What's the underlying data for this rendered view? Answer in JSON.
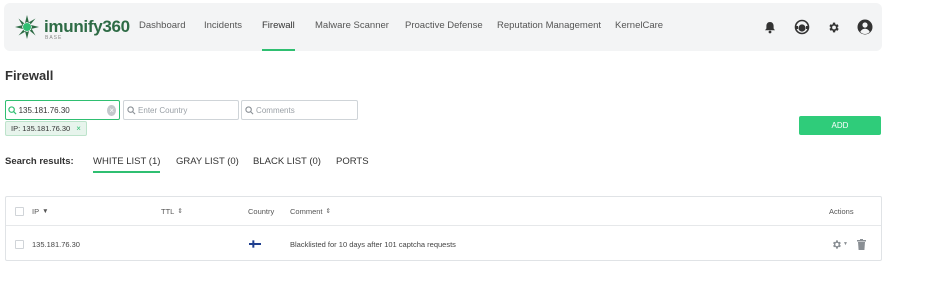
{
  "brand": {
    "name": "imunify360",
    "sub": "BASE",
    "color": "#2d6b45"
  },
  "nav": [
    {
      "label": "Dashboard"
    },
    {
      "label": "Incidents"
    },
    {
      "label": "Firewall",
      "active": true
    },
    {
      "label": "Malware Scanner"
    },
    {
      "label": "Proactive Defense"
    },
    {
      "label": "Reputation Management"
    },
    {
      "label": "KernelCare"
    }
  ],
  "top_icons": [
    "bell-icon",
    "support-icon",
    "gear-icon",
    "user-avatar-icon"
  ],
  "page": {
    "title": "Firewall"
  },
  "filters": {
    "ip_value": "135.181.76.30",
    "country_placeholder": "Enter Country",
    "comments_placeholder": "Comments",
    "chip": "IP: 135.181.76.30",
    "chip_close": "×"
  },
  "add_label": "ADD",
  "results": {
    "label": "Search results:",
    "tabs": [
      {
        "label": "WHITE LIST (1)",
        "active": true
      },
      {
        "label": "GRAY LIST (0)"
      },
      {
        "label": "BLACK LIST (0)"
      },
      {
        "label": "PORTS"
      }
    ]
  },
  "table": {
    "headers": {
      "ip": "IP",
      "ttl": "TTL",
      "country": "Country",
      "comment": "Comment",
      "actions": "Actions"
    },
    "rows": [
      {
        "ip": "135.181.76.30",
        "country": "FI",
        "comment": "Blacklisted for 10 days after 101 captcha requests"
      }
    ]
  },
  "colors": {
    "accent": "#2fbf71",
    "button": "#2fcc7a",
    "nav_bg": "#f3f4f5",
    "flag_blue": "#1f3f8f"
  }
}
